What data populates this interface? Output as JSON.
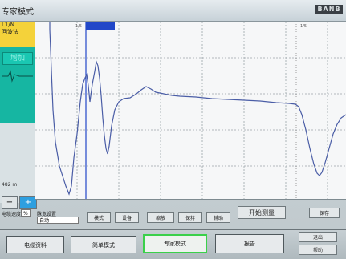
{
  "title": "专家模式",
  "logo": "BANB",
  "left_panel": {
    "info_line1": "L1/N",
    "info_line2": "回波法",
    "wave_button": "增加",
    "length_label": "482 m"
  },
  "zoom": {
    "minus": "−",
    "plus": "+"
  },
  "ruler": {
    "tag_a": "1/5",
    "tag_b": "1/5"
  },
  "controls": {
    "speed_label": "电缆速度",
    "speed_unit": "%",
    "range_label": "脉宽设置",
    "range_value": "自动",
    "btn_mode": "模式",
    "btn_device": "设备",
    "btn_zoom": "缩放",
    "btn_hold": "保持",
    "btn_aux": "辅助",
    "start": "开始测量",
    "save": "保存"
  },
  "bottom": {
    "cable_info": "电缆资料",
    "simple_mode": "简单模式",
    "expert_mode": "专家模式",
    "report": "报告",
    "exit": "退出",
    "help": "帮助"
  },
  "colors": {
    "accent": "#3ad04a",
    "trace": "#4a5da6",
    "cursor": "#2147c8"
  }
}
